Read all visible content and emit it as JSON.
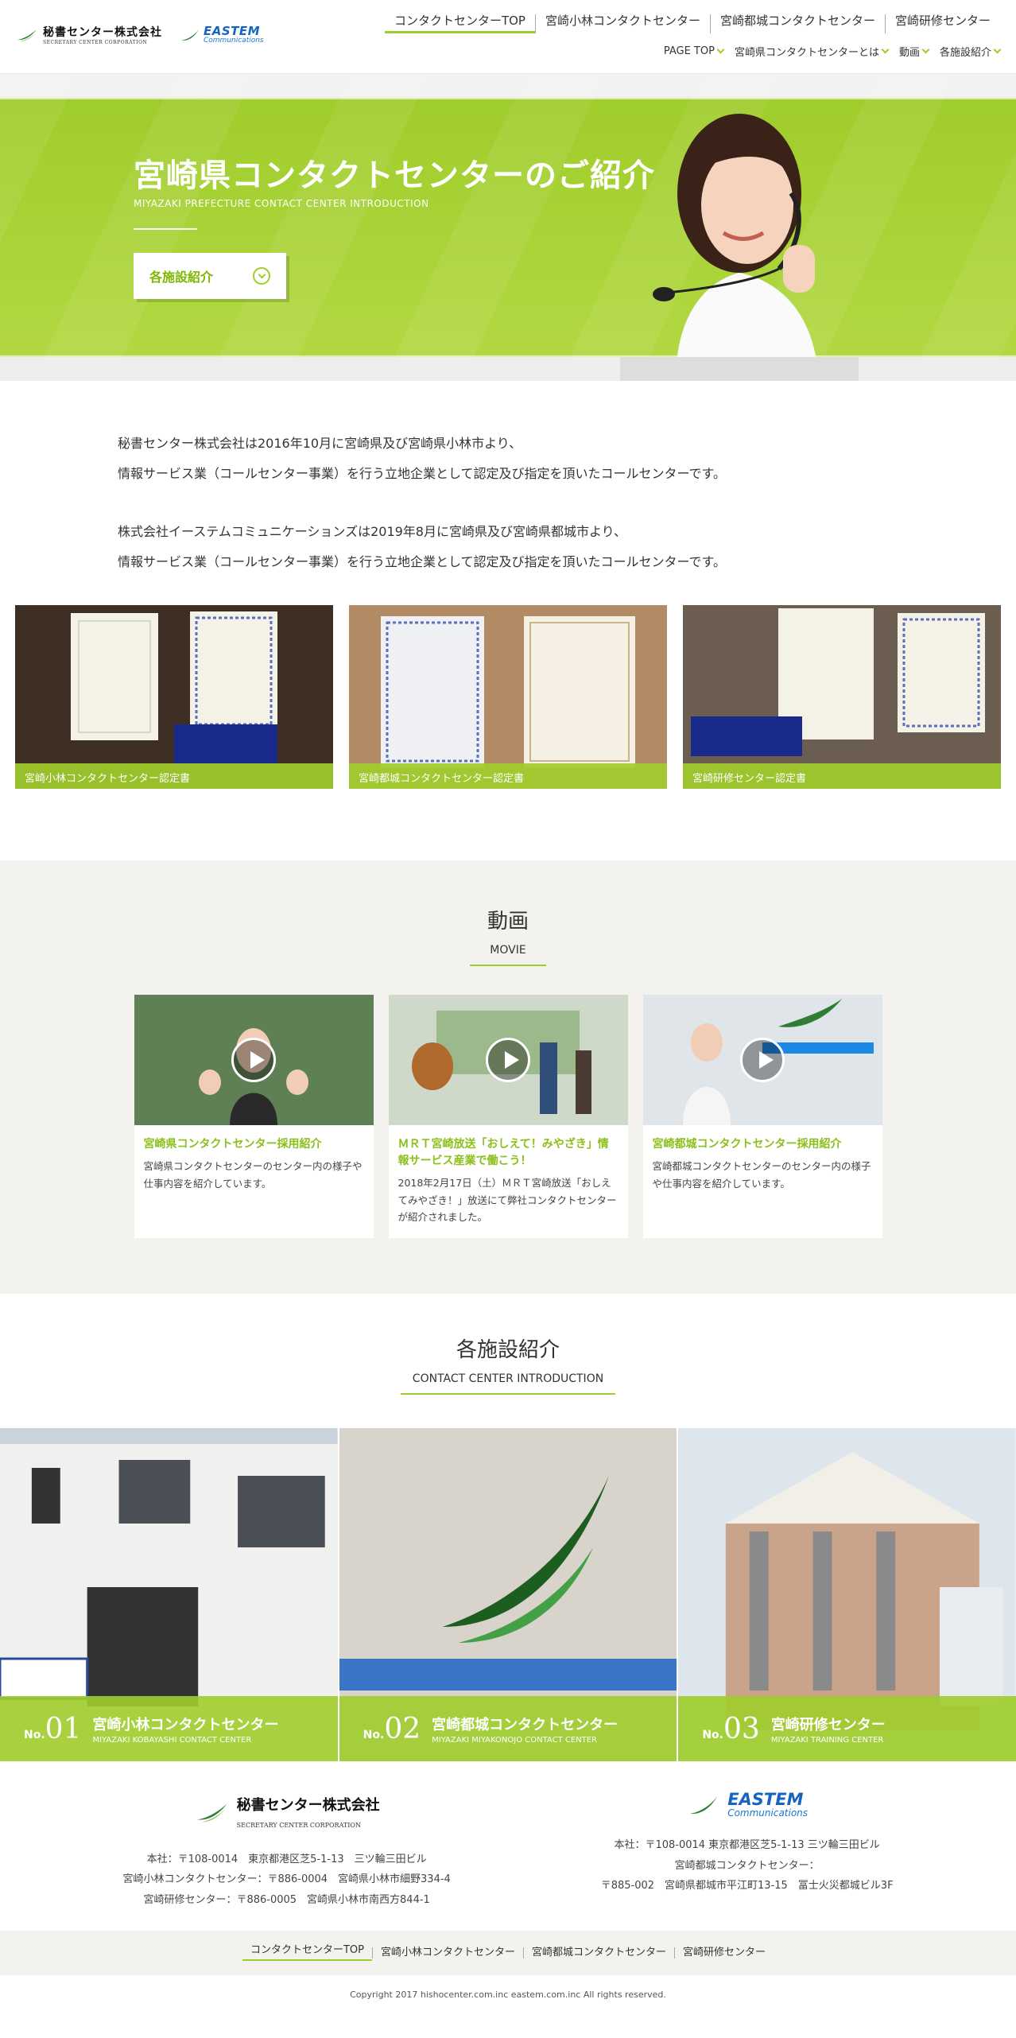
{
  "brand": {
    "hisho_jp": "秘書センター株式会社",
    "hisho_en": "SECRETARY CENTER CORPORATION",
    "eastem_1": "EASTEM",
    "eastem_2": "Communications",
    "accent": "#9fcd2b"
  },
  "topnav": [
    "コンタクトセンターTOP",
    "宮崎小林コンタクトセンター",
    "宮崎都城コンタクトセンター",
    "宮崎研修センター"
  ],
  "subnav": [
    "PAGE TOP",
    "宮崎県コンタクトセンターとは",
    "動画",
    "各施設紹介"
  ],
  "hero": {
    "title": "宮崎県コンタクトセンターのご紹介",
    "subtitle": "MIYAZAKI PREFECTURE CONTACT CENTER INTRODUCTION",
    "button": "各施設紹介"
  },
  "intro": {
    "p1_l1": "秘書センター株式会社は2016年10月に宮崎県及び宮崎県小林市より、",
    "p1_l2": "情報サービス業（コールセンター事業）を行う立地企業として認定及び指定を頂いたコールセンターです。",
    "p2_l1": "株式会社イーステムコミュニケーションズは2019年8月に宮崎県及び宮崎県都城市より、",
    "p2_l2": "情報サービス業（コールセンター事業）を行う立地企業として認定及び指定を頂いたコールセンターです。"
  },
  "certs": [
    "宮崎小林コンタクトセンター認定書",
    "宮崎都城コンタクトセンター認定書",
    "宮崎研修センター認定書"
  ],
  "movie": {
    "title": "動画",
    "en": "MOVIE",
    "cards": [
      {
        "title": "宮崎県コンタクトセンター採用紹介",
        "desc": "宮崎県コンタクトセンターのセンター内の様子や仕事内容を紹介しています。"
      },
      {
        "title": "ＭＲＴ宮崎放送「おしえて！みやざき」情報サービス産業で働こう！",
        "desc": "2018年2月17日（土）ＭＲＴ宮崎放送「おしえてみやざき！」放送にて弊社コンタクトセンターが紹介されました。"
      },
      {
        "title": "宮崎都城コンタクトセンター採用紹介",
        "desc": "宮崎都城コンタクトセンターのセンター内の様子や仕事内容を紹介しています。"
      }
    ]
  },
  "facilities": {
    "title": "各施設紹介",
    "en": "CONTACT CENTER INTRODUCTION",
    "items": [
      {
        "no": "No.",
        "n": "01",
        "jp": "宮崎小林コンタクトセンター",
        "en": "MIYAZAKI KOBAYASHI CONTACT CENTER"
      },
      {
        "no": "No.",
        "n": "02",
        "jp": "宮崎都城コンタクトセンター",
        "en": "MIYAZAKI MIYAKONOJO CONTACT CENTER"
      },
      {
        "no": "No.",
        "n": "03",
        "jp": "宮崎研修センター",
        "en": "MIYAZAKI TRAINING CENTER"
      }
    ]
  },
  "footer": {
    "hisho_lines": [
      "本社：〒108-0014　東京都港区芝5-1-13　三ツ輪三田ビル",
      "宮崎小林コンタクトセンター：〒886-0004　宮崎県小林市細野334-4",
      "宮崎研修センター：〒886-0005　宮崎県小林市南西方844-1"
    ],
    "eastem_lines": [
      "本社：〒108-0014 東京都港区芝5-1-13 三ツ輪三田ビル",
      "宮崎都城コンタクトセンター：",
      "〒885-002　宮崎県都城市平江町13-15　冨士火災都城ビル3F"
    ],
    "nav": [
      "コンタクトセンターTOP",
      "宮崎小林コンタクトセンター",
      "宮崎都城コンタクトセンター",
      "宮崎研修センター"
    ],
    "copyright": "Copyright 2017 hishocenter.com.inc eastem.com.inc All rights reserved."
  }
}
